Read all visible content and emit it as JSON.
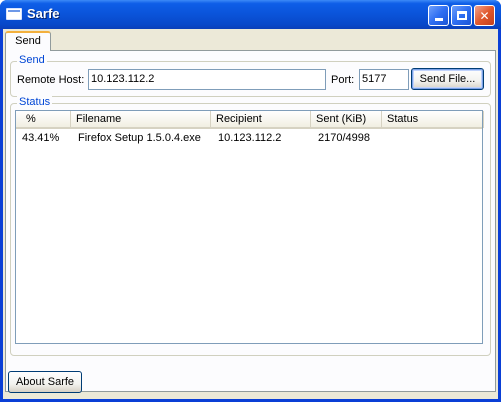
{
  "window": {
    "title": "Sarfe"
  },
  "tabs": [
    {
      "label": "Send"
    }
  ],
  "send_group": {
    "title": "Send",
    "remote_host_label": "Remote Host:",
    "remote_host_value": "10.123.112.2",
    "port_label": "Port:",
    "port_value": "5177",
    "send_file_label": "Send File..."
  },
  "status_group": {
    "title": "Status",
    "columns": [
      "%",
      "Filename",
      "Recipient",
      "Sent (KiB)",
      "Status"
    ],
    "rows": [
      [
        "43.41%",
        "Firefox Setup 1.5.0.4.exe",
        "10.123.112.2",
        "2170/4998",
        ""
      ]
    ]
  },
  "footer": {
    "about_label": "About Sarfe"
  },
  "colors": {
    "titlebar": "#0a53d9",
    "group_title": "#0046d5",
    "dialog_bg": "#ece9d8"
  }
}
